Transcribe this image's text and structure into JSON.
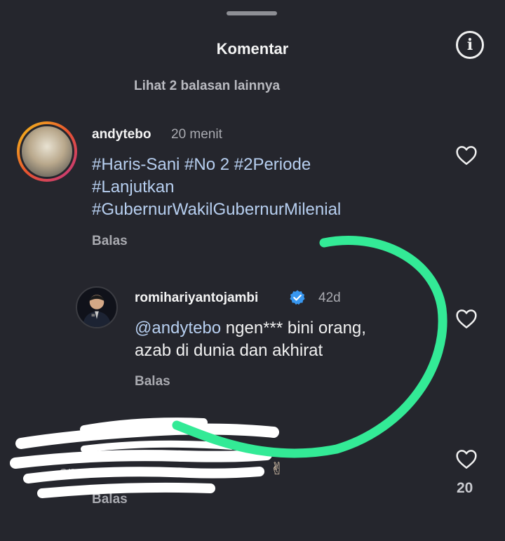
{
  "header": {
    "title": "Komentar"
  },
  "thread": {
    "more_replies": "Lihat 2 balasan lainnya"
  },
  "comment": {
    "username": "andytebo",
    "time": "20 menit",
    "lines": [
      "#Haris-Sani #No 2 #2Periode",
      "#Lanjutkan",
      "#GubernurWakilGubernurMilenial"
    ],
    "reply_label": "Balas"
  },
  "reply": {
    "username": "romihariyantojambi",
    "time": "42d",
    "mention": "@andytebo",
    "text_1": " ngen*** bini orang,",
    "text_2": "azab di dunia dan akhirat",
    "reply_label": "Balas"
  },
  "next_comment": {
    "partial_text": "... an",
    "like_count": "20",
    "reply_label": "Balas"
  },
  "colors": {
    "background": "#25262d",
    "hashtag": "#b7cff0",
    "annotation": "#33ea96",
    "redaction": "#ffffff"
  }
}
